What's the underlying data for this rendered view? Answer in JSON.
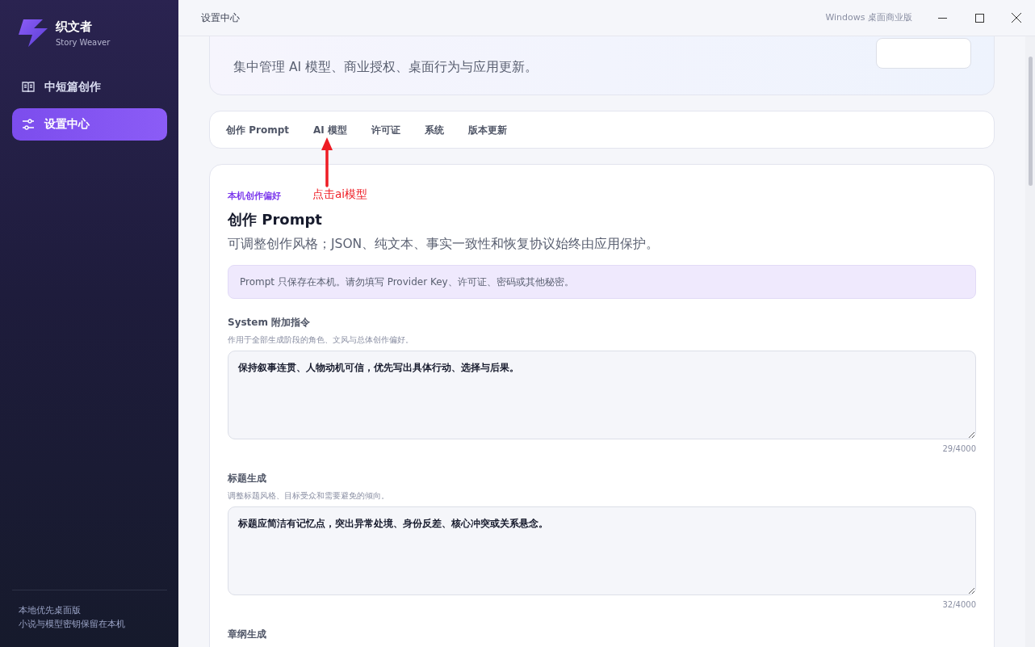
{
  "app": {
    "name": "织文者",
    "subtitle": "Story Weaver"
  },
  "sidebar": {
    "items": [
      {
        "label": "中短篇创作",
        "selected": false
      },
      {
        "label": "设置中心",
        "selected": true
      }
    ],
    "footer": [
      "本地优先桌面版",
      "小说与模型密钥保留在本机"
    ]
  },
  "title_bar": {
    "title": "设置中心",
    "edition": "Windows 桌面商业版"
  },
  "header": {
    "subtitle": "集中管理 AI 模型、商业授权、桌面行为与应用更新。"
  },
  "tabs": [
    {
      "label": "创作 Prompt"
    },
    {
      "label": "AI 模型"
    },
    {
      "label": "许可证"
    },
    {
      "label": "系统"
    },
    {
      "label": "版本更新"
    }
  ],
  "annotation": {
    "text": "点击ai模型"
  },
  "panel": {
    "eyebrow": "本机创作偏好",
    "title": "创作 Prompt",
    "description": "可调整创作风格；JSON、纯文本、事实一致性和恢复协议始终由应用保护。",
    "notice": "Prompt 只保存在本机。请勿填写 Provider Key、许可证、密码或其他秘密。",
    "fields": [
      {
        "label": "System 附加指令",
        "hint": "作用于全部生成阶段的角色、文风与总体创作偏好。",
        "value": "保持叙事连贯、人物动机可信，优先写出具体行动、选择与后果。",
        "count": "29/4000"
      },
      {
        "label": "标题生成",
        "hint": "调整标题风格、目标受众和需要避免的倾向。",
        "value": "标题应简洁有记忆点，突出异常处境、身份反差、核心冲突或关系悬念。",
        "count": "32/4000"
      },
      {
        "label": "章纲生成"
      }
    ]
  }
}
